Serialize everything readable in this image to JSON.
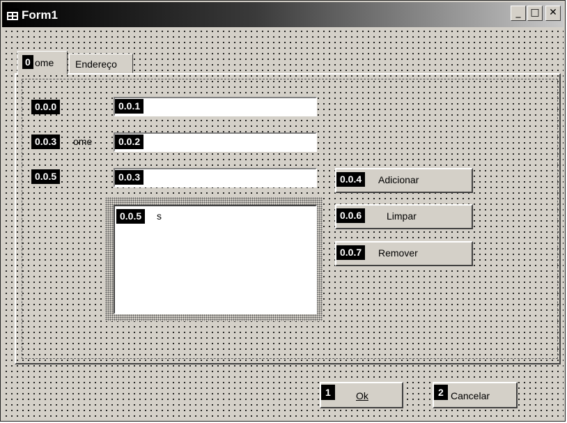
{
  "window": {
    "title": "Form1",
    "controls": {
      "minimize": "_",
      "maximize": "□",
      "close": "✕"
    }
  },
  "tabs": [
    {
      "badge": "0",
      "label": "ome"
    },
    {
      "label": "Endereço"
    }
  ],
  "form": {
    "labels": [
      {
        "badge": "0.0.0"
      },
      {
        "badge": "0.0.3",
        "text": "ome"
      },
      {
        "badge": "0.0.5"
      }
    ],
    "textboxes": [
      {
        "badge": "0.0.1",
        "value": ""
      },
      {
        "badge": "0.0.2",
        "value": ""
      },
      {
        "badge": "0.0.3",
        "value": ""
      }
    ],
    "listbox": {
      "badge": "0.0.5",
      "text": "s"
    },
    "buttons": [
      {
        "badge": "0.0.4",
        "label": "Adicionar"
      },
      {
        "badge": "0.0.6",
        "label": "Limpar"
      },
      {
        "badge": "0.0.7",
        "label": "Remover"
      }
    ]
  },
  "footer": {
    "ok": {
      "badge": "1",
      "label": "Ok"
    },
    "cancel": {
      "badge": "2",
      "label": "Cancelar"
    }
  },
  "icons": [
    "form-window-icon",
    "minimize-icon",
    "maximize-icon",
    "close-icon"
  ]
}
